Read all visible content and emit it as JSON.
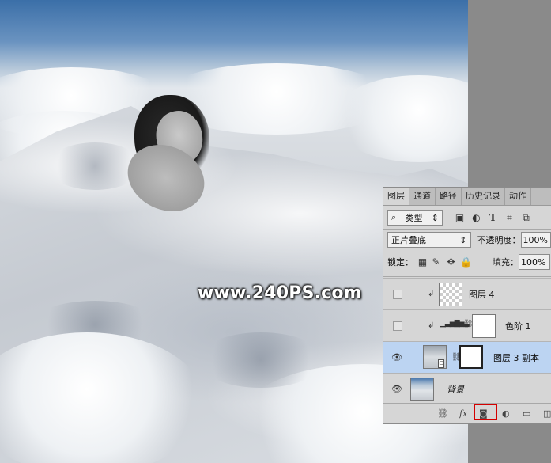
{
  "watermark": "www.240PS.com",
  "panel": {
    "tabs": [
      "图层",
      "通道",
      "路径",
      "历史记录",
      "动作"
    ],
    "filter": {
      "search_icon": "⌕",
      "kind_label": "类型",
      "icons": [
        "image-filter-icon",
        "adjustment-filter-icon",
        "type-filter-icon",
        "shape-filter-icon",
        "smart-object-filter-icon"
      ]
    },
    "blend_mode": "正片叠底",
    "opacity_label": "不透明度：",
    "opacity_value": "100%",
    "lock_label": "锁定：",
    "fill_label": "填充：",
    "fill_value": "100%",
    "layers": [
      {
        "name": "图层 4",
        "visible": false,
        "clipped": true,
        "thumb": "transparent"
      },
      {
        "name": "色阶 1",
        "visible": false,
        "clipped": true,
        "thumb": "levels-adjustment"
      },
      {
        "name": "图层 3 副本",
        "visible": true,
        "selected": true,
        "thumb": "photo-with-mask"
      },
      {
        "name": "背景",
        "visible": true,
        "thumb": "photo"
      }
    ],
    "footer_buttons": [
      "link-layers-icon",
      "fx-icon",
      "add-mask-icon",
      "adjustment-icon",
      "folder-icon",
      "new-layer-icon"
    ],
    "footer_fx": "fx"
  },
  "colors": {
    "selected_row": "#bcd4f2",
    "highlight": "#d40000"
  }
}
